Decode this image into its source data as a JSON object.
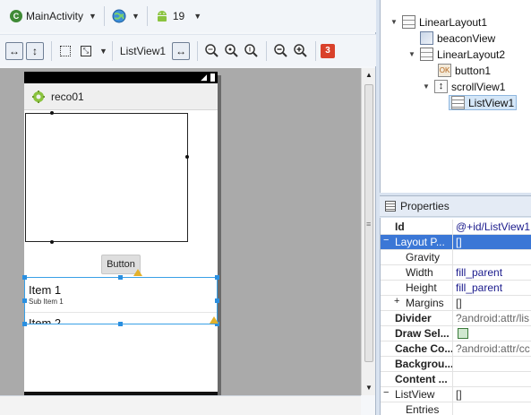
{
  "toolbar": {
    "activity": "MainActivity",
    "api_level": "19",
    "palette_label": "ListView1",
    "error_count": "3"
  },
  "device": {
    "app_title": "reco01"
  },
  "layout": {
    "button_label": "Button",
    "list_items": [
      {
        "title": "Item 1",
        "subtitle": "Sub Item 1"
      },
      {
        "title": "Item 2"
      }
    ]
  },
  "outline": {
    "nodes": [
      {
        "label": "LinearLayout1",
        "expand": "▼"
      },
      {
        "label": "beaconView",
        "expand": ""
      },
      {
        "label": "LinearLayout2",
        "expand": "▼"
      },
      {
        "label": "button1",
        "expand": ""
      },
      {
        "label": "scrollView1",
        "expand": "▼"
      },
      {
        "label": "ListView1",
        "expand": ""
      }
    ]
  },
  "properties": {
    "title": "Properties",
    "rows": [
      {
        "name": "Id",
        "value": "@+id/ListView1"
      },
      {
        "name": "Layout P...",
        "value": "[]",
        "expand": "−"
      },
      {
        "name": "Gravity",
        "value": ""
      },
      {
        "name": "Width",
        "value": "fill_parent"
      },
      {
        "name": "Height",
        "value": "fill_parent"
      },
      {
        "name": "Margins",
        "value": "[]",
        "expand": "+"
      },
      {
        "name": "Divider",
        "value": "?android:attr/lis"
      },
      {
        "name": "Draw Sel...",
        "value": ""
      },
      {
        "name": "Cache Co...",
        "value": "?android:attr/cc"
      },
      {
        "name": "Backgrou...",
        "value": ""
      },
      {
        "name": "Content ...",
        "value": ""
      },
      {
        "name": "ListView",
        "value": "[]",
        "expand": "−"
      },
      {
        "name": "Entries",
        "value": ""
      }
    ]
  },
  "colors": {
    "selection": "#3b77d6",
    "error_badge": "#d9412b",
    "android_green": "#8ac33e",
    "handle_blue": "#2a8fe0"
  }
}
